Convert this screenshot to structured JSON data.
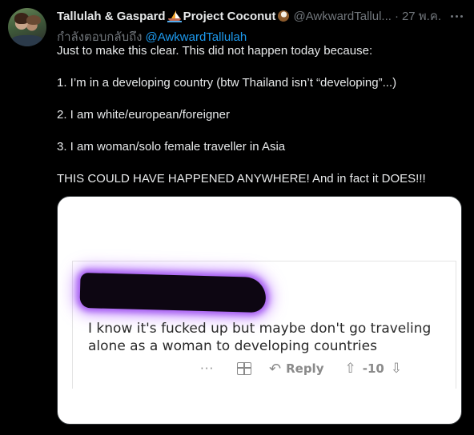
{
  "tweet": {
    "author": {
      "name_part1": "Tallulah & Gaspard",
      "name_part2": "Project Coconut",
      "boat_emoji": "sailboat-icon",
      "coconut_emoji": "coconut-icon",
      "handle": "@AwkwardTallul...",
      "separator": "·",
      "time": "27 พ.ค."
    },
    "reply_prefix": "กำลังตอบกลับถึง",
    "reply_mention": "@AwkwardTallulah",
    "paragraphs": [
      "Just to make this clear. This did not happen today because:",
      "1. I’m in a developing country (btw Thailand isn’t “developing”...)",
      "2. I am white/european/foreigner",
      "3. I am woman/solo female traveller in Asia",
      "THIS COULD HAVE HAPPENED ANYWHERE! And in fact it DOES!!!"
    ],
    "media": {
      "comment_line1": "I know it's fucked up but maybe don't go traveling",
      "comment_line2": "alone as a woman to developing countries",
      "actions": {
        "more": "···",
        "reply_label": "Reply",
        "score": "-10"
      }
    }
  },
  "colors": {
    "background": "#000000",
    "text": "#e7e9ea",
    "muted": "#71767b",
    "link": "#1d9bf0",
    "redaction_glow": "#a45cf0"
  }
}
